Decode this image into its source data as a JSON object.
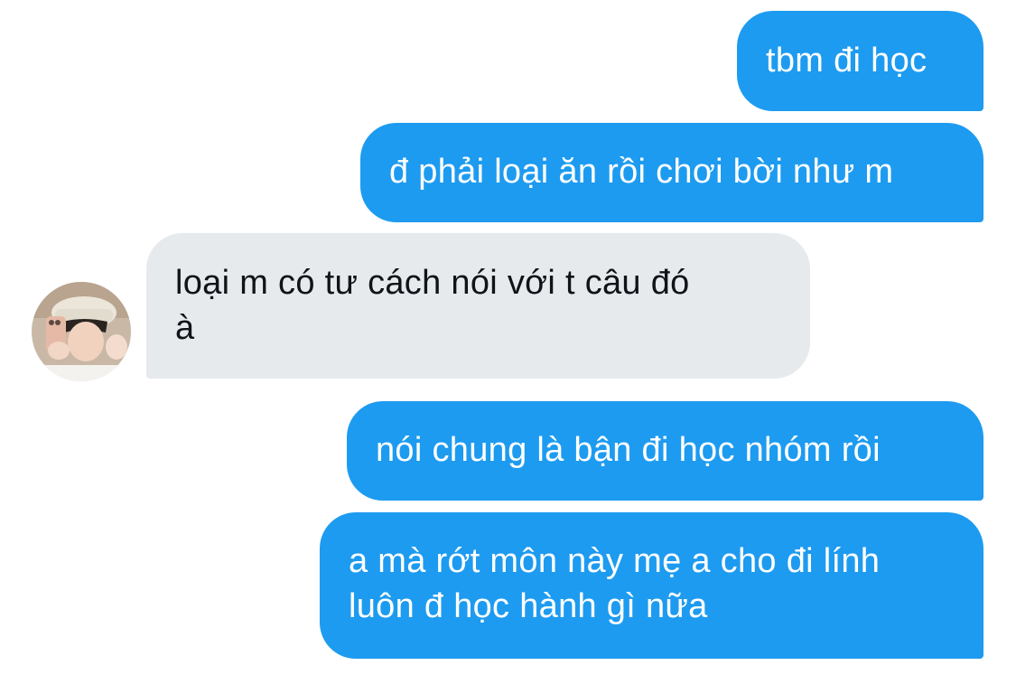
{
  "conversation": {
    "messages": [
      {
        "direction": "outgoing",
        "text": "tbm đi học"
      },
      {
        "direction": "outgoing",
        "text": "đ phải loại ăn rồi chơi bời như m"
      },
      {
        "direction": "incoming",
        "text": "loại m có tư cách nói với t câu đó\nà"
      },
      {
        "direction": "outgoing",
        "text": "nói chung là bận đi học nhóm rồi"
      },
      {
        "direction": "outgoing",
        "text": "a mà rớt môn này mẹ a cho đi lính\nluôn đ học hành gì nữa"
      }
    ]
  },
  "contact": {
    "avatar_icon": "user-photo-avatar"
  },
  "colors": {
    "outgoing_bubble": "#1d9bf0",
    "incoming_bubble": "#e7eaed",
    "incoming_text": "#0f1419",
    "outgoing_text": "#ffffff",
    "background": "#ffffff"
  }
}
